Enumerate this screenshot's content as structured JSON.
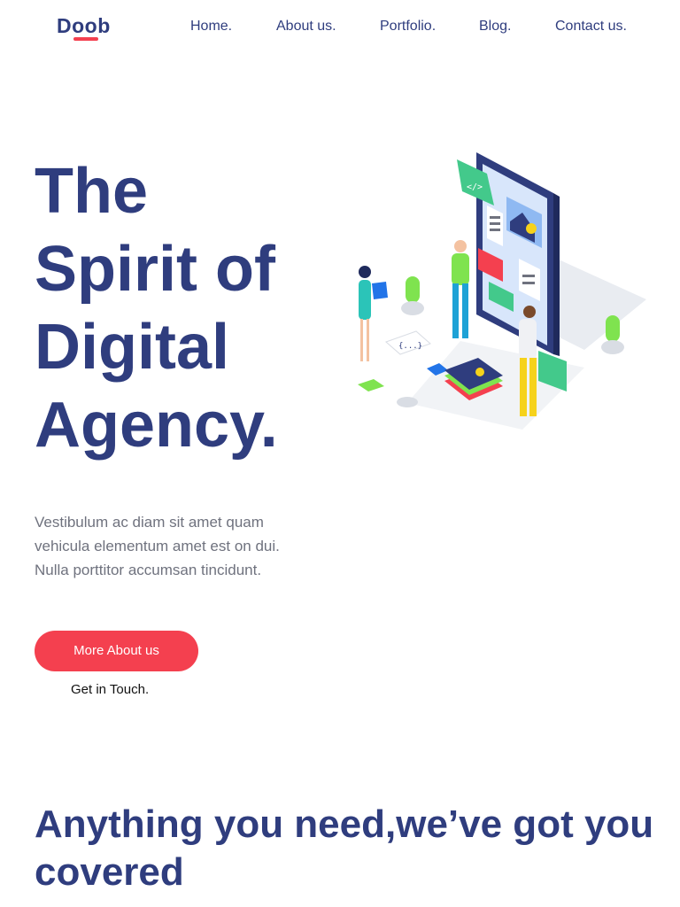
{
  "header": {
    "logo_text": "Doob",
    "nav": [
      "Home.",
      "About us.",
      "Portfolio.",
      "Blog.",
      "Contact us."
    ]
  },
  "hero": {
    "title_lines": [
      "The",
      "Spirit of",
      "Digital",
      "Agency."
    ],
    "description": "Vestibulum ac diam sit amet quam vehicula elementum amet est on dui. Nulla porttitor accumsan tincidunt.",
    "primary_button": "More About us",
    "secondary_link": "Get in Touch.",
    "illustration": {
      "code_tag": "</>",
      "braces_tag": "{...}",
      "colors": {
        "phone": "#2f3d7e",
        "screen": "#d8e6fb",
        "accent_green": "#43c98b",
        "accent_red": "#f4404f",
        "accent_yellow": "#f6d21b",
        "plant": "#7fe34f"
      }
    }
  },
  "services": {
    "title": "Anything you need,we’ve got you covered"
  },
  "colors": {
    "brand": "#2f3d7e",
    "accent": "#f4404f",
    "body_text": "#6f727e"
  }
}
